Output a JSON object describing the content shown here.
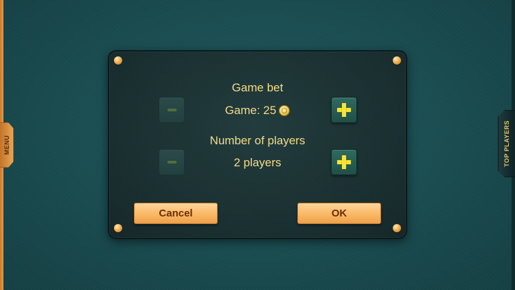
{
  "side_tabs": {
    "menu_label": "MENU",
    "top_players_label": "TOP PLAYERS"
  },
  "dialog": {
    "game_bet": {
      "label": "Game bet",
      "value_text": "Game: 25",
      "icon": "coin-icon",
      "minus_enabled": false,
      "plus_enabled": true
    },
    "players": {
      "label": "Number of players",
      "value_text": "2 players",
      "minus_enabled": false,
      "plus_enabled": true
    },
    "cancel_label": "Cancel",
    "ok_label": "OK"
  },
  "colors": {
    "felt": "#1a4e52",
    "dialog_bg": "#192e30",
    "text_gold": "#f2dc8a",
    "button_orange": "#f9b865",
    "button_text": "#6a2e0a",
    "plus_yellow": "#f6e436"
  }
}
